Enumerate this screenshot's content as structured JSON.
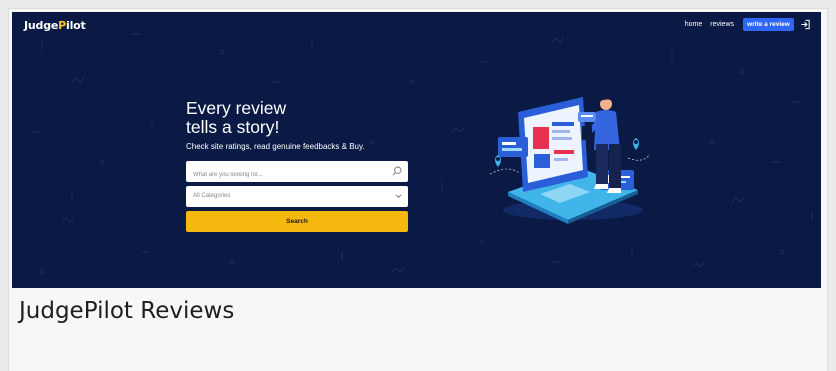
{
  "brand": {
    "prefix": "Judge",
    "highlight": "P",
    "suffix": "ilot"
  },
  "nav": {
    "home_label": "home",
    "reviews_label": "reviews",
    "cta_label": "write a review",
    "login_icon": "sign-in-icon"
  },
  "hero": {
    "headline_line1": "Every review",
    "headline_line2": "tells a story!",
    "subheadline": "Check site ratings, read genuine feedbacks & Buy.",
    "illustration_icon": "person-with-laptop-reviews-illustration"
  },
  "search": {
    "placeholder": "What are you looking for...",
    "value": "",
    "icon": "search-icon"
  },
  "category": {
    "selected": "All Categories",
    "icon": "chevron-down-icon"
  },
  "search_button_label": "Search",
  "page_title": "JudgePilot Reviews",
  "colors": {
    "hero_background": "#0a1a45",
    "brand_accent": "#f5c518",
    "cta_button": "#2f66f5",
    "search_button": "#f5b80f"
  }
}
